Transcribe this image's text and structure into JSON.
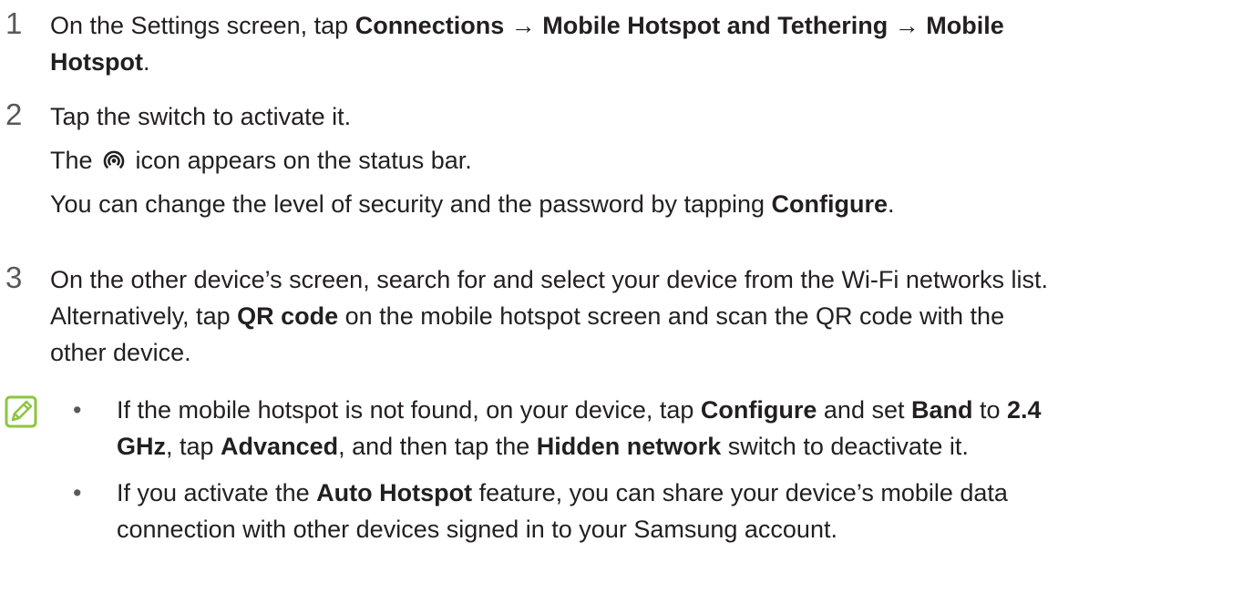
{
  "steps": [
    {
      "number": "1",
      "lines": [
        [
          "On the Settings screen, tap ",
          "Connections",
          " → ",
          "Mobile Hotspot and Tethering",
          " → ",
          "Mobile"
        ],
        [
          "",
          "Hotspot",
          "."
        ]
      ]
    },
    {
      "number": "2",
      "line1": "Tap the switch to activate it.",
      "line2_before": "The ",
      "line2_after": " icon appears on the status bar.",
      "line3_text": "You can change the level of security and the password by tapping ",
      "line3_bold": "Configure",
      "line3_end": "."
    },
    {
      "number": "3",
      "line1": "On the other device’s screen, search for and select your device from the Wi-Fi networks list.",
      "line2_text": "Alternatively, tap ",
      "line2_bold": "QR code",
      "line2_after": " on the mobile hotspot screen and scan the QR code with the",
      "line3": "other device."
    }
  ],
  "note": {
    "icon": "note-pencil-icon",
    "bullet_glyph": "•",
    "bullets": [
      {
        "l1": [
          "If the mobile hotspot is not found, on your device, tap ",
          "Configure",
          " and set ",
          "Band",
          " to ",
          "2.4"
        ],
        "l2": [
          "GHz",
          ", tap ",
          "Advanced",
          ", and then tap the ",
          "Hidden network",
          " switch to deactivate it."
        ]
      },
      {
        "l1": [
          "If you activate the ",
          "Auto Hotspot",
          " feature, you can share your device’s mobile data"
        ],
        "l2": [
          "connection with other devices signed in to your Samsung account."
        ]
      }
    ]
  },
  "icons": {
    "hotspot": "hotspot-status-icon",
    "accent_color": "#8dc63f"
  }
}
